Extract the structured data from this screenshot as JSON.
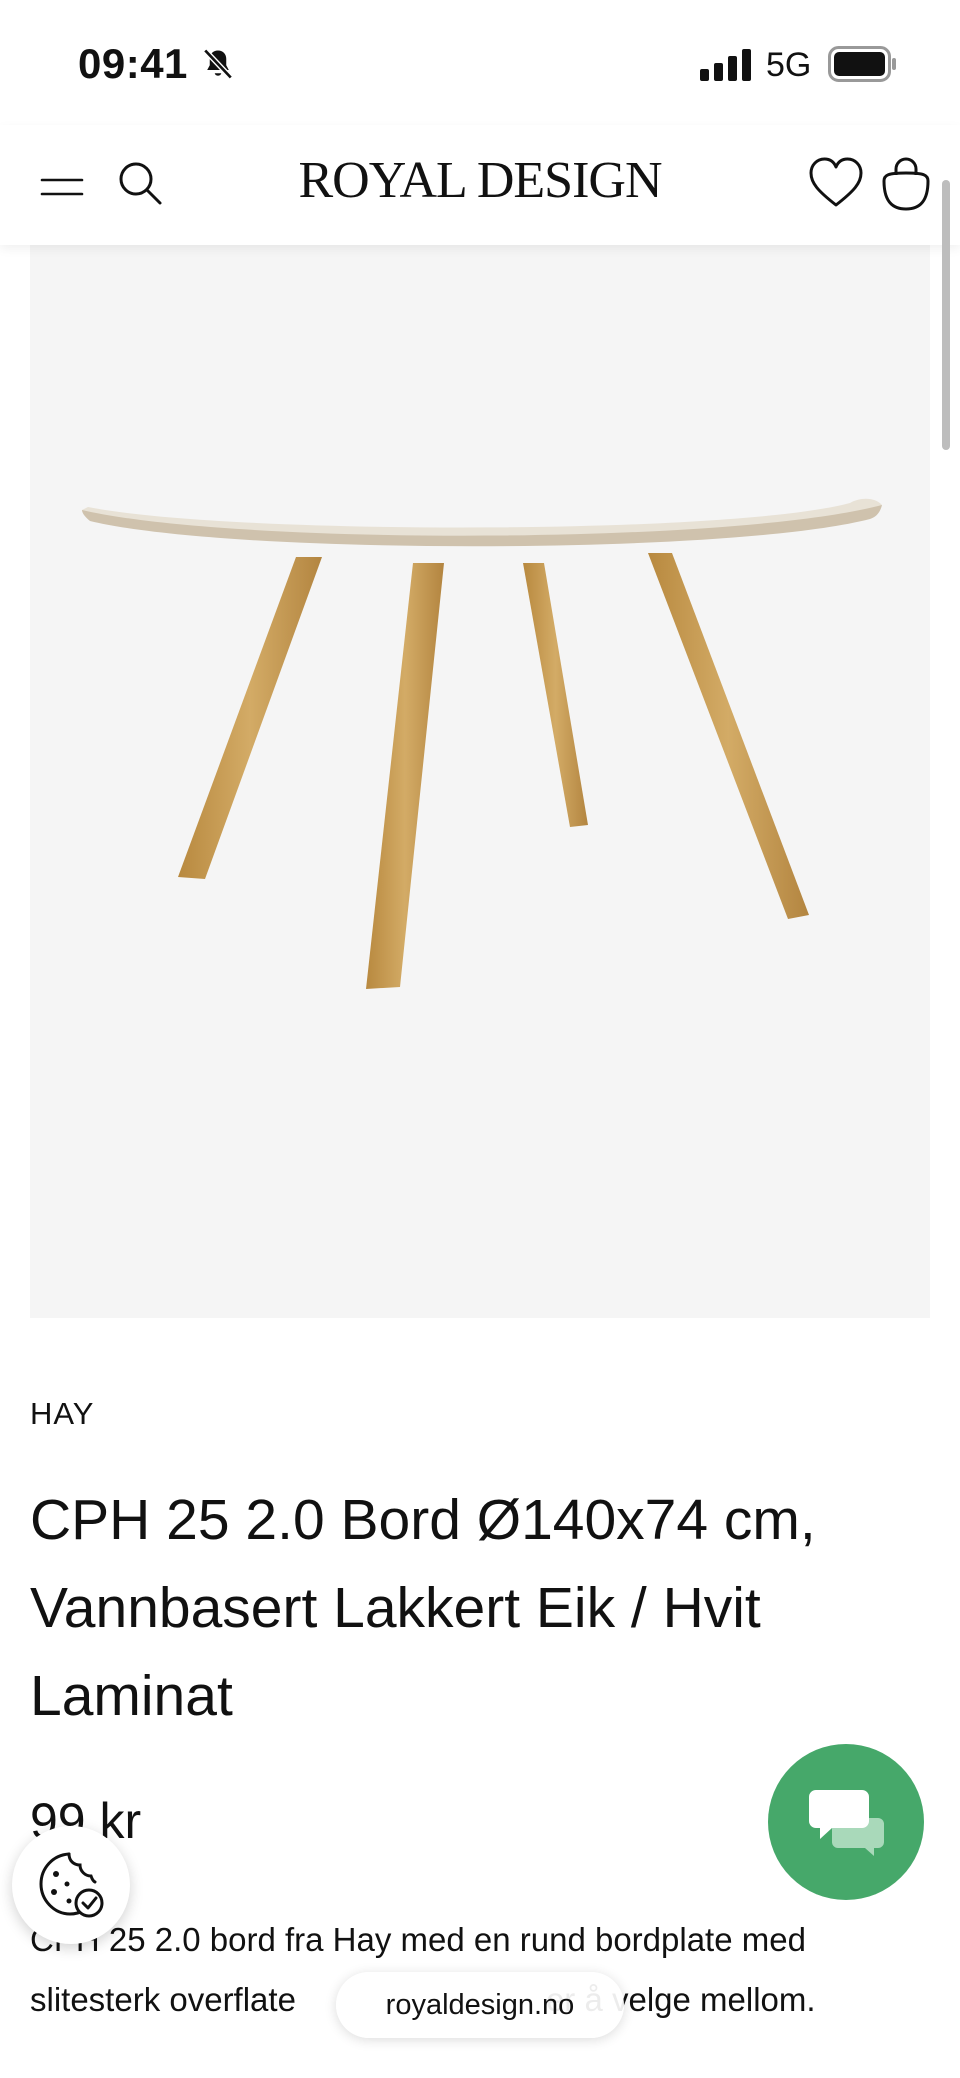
{
  "status_bar": {
    "time": "09:41",
    "network": "5G",
    "icons": [
      "bell-slash-icon",
      "signal-icon",
      "battery-icon"
    ]
  },
  "header": {
    "logo": "ROYAL DESIGN",
    "icons": [
      "menu-icon",
      "search-icon",
      "heart-icon",
      "bag-icon"
    ]
  },
  "product": {
    "brand": "HAY",
    "title": "CPH 25 2.0 Bord Ø140x74 cm, Vannbasert Lakkert Eik / Hvit Laminat",
    "price": "99 kr",
    "description": "CPH 25 2.0 bord fra Hay med en rund bordplate med slitesterk overflate",
    "description_tail": "er å velge mellom."
  },
  "browser": {
    "url": "royaldesign.no"
  },
  "floating": {
    "icons": [
      "cookie-icon",
      "chat-icon"
    ],
    "chat_color": "#46a86a"
  },
  "colors": {
    "image_bg": "#f5f5f5",
    "text": "#111111"
  }
}
